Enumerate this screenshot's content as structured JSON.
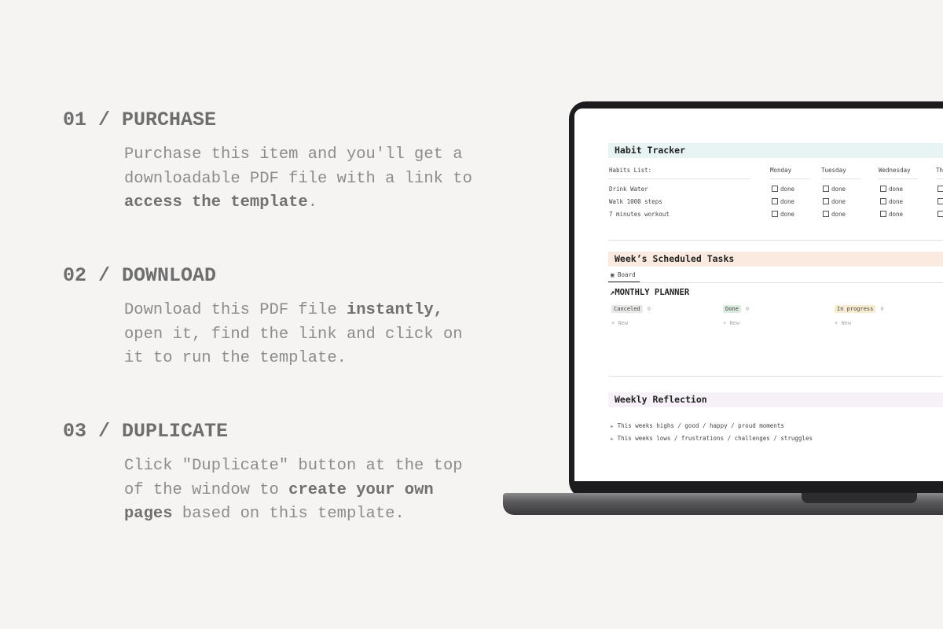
{
  "steps": [
    {
      "title": "01 / PURCHASE",
      "lines": [
        [
          {
            "t": "Purchase this item and you'll get a"
          }
        ],
        [
          {
            "t": "downloadable PDF file with a link to"
          }
        ],
        [
          {
            "t": "access the template",
            "b": true
          },
          {
            "t": "."
          }
        ]
      ]
    },
    {
      "title": "02 / DOWNLOAD",
      "lines": [
        [
          {
            "t": "Download this PDF file "
          },
          {
            "t": "instantly,",
            "b": true
          }
        ],
        [
          {
            "t": "open it, find the link and click on"
          }
        ],
        [
          {
            "t": "it to run the template."
          }
        ]
      ]
    },
    {
      "title": "03 / DUPLICATE",
      "lines": [
        [
          {
            "t": "Click \"Duplicate\" button at the top"
          }
        ],
        [
          {
            "t": "of the window to "
          },
          {
            "t": "create your own",
            "b": true
          }
        ],
        [
          {
            "t": "pages",
            "b": true
          },
          {
            "t": " based on this template."
          }
        ]
      ]
    }
  ],
  "habit": {
    "title": "Habit Tracker",
    "list_header": "Habits List:",
    "days": [
      "Monday",
      "Tuesday",
      "Wednesday",
      "Th"
    ],
    "habits": [
      "Drink Water",
      "Walk 1000 steps",
      "7 minutes workout"
    ],
    "check_label": "done",
    "color": "#e8f3f3"
  },
  "tasks": {
    "title": "Week’s Scheduled Tasks",
    "view": "Board",
    "planner": "MONTHLY PLANNER",
    "color": "#fbeadf",
    "columns": [
      {
        "label": "Canceled",
        "count": "0",
        "bg": "#e8e8e6"
      },
      {
        "label": "Done",
        "count": "0",
        "bg": "#dcecdf"
      },
      {
        "label": "In progress",
        "count": "0",
        "bg": "#f8ecd0"
      }
    ],
    "new_label": "New"
  },
  "reflection": {
    "title": "Weekly Reflection",
    "color": "#f6f0f7",
    "items": [
      "This weeks highs / good / happy / proud moments",
      "This weeks lows / frustrations / challenges / struggles"
    ]
  }
}
